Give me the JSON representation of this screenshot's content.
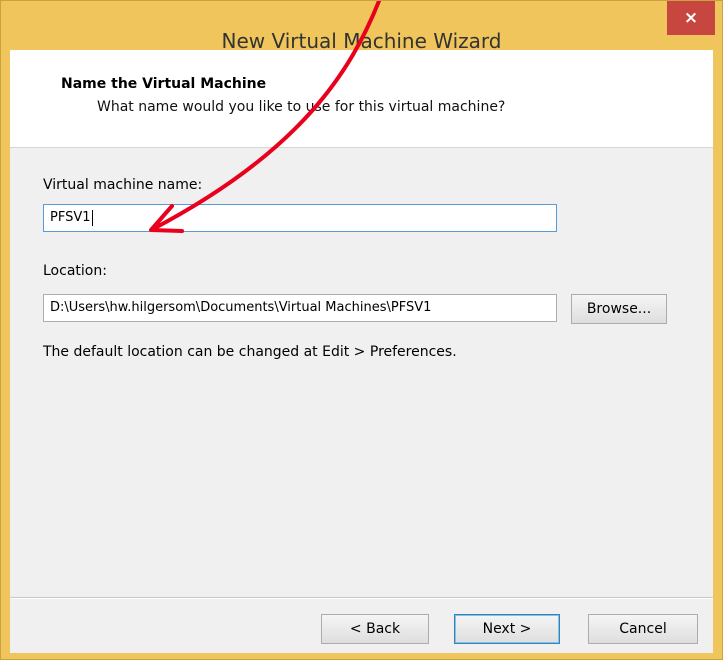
{
  "window": {
    "title": "New Virtual Machine Wizard",
    "close_glyph": "×"
  },
  "header": {
    "title": "Name the Virtual Machine",
    "subtitle": "What name would you like to use for this virtual machine?"
  },
  "form": {
    "name_label": "Virtual machine name:",
    "name_value": "PFSV1",
    "location_label": "Location:",
    "location_value": "D:\\Users\\hw.hilgersom\\Documents\\Virtual Machines\\PFSV1",
    "browse_label": "Browse...",
    "hint": "The default location can be changed at Edit > Preferences."
  },
  "footer": {
    "back_label": "< Back",
    "next_label": "Next >",
    "cancel_label": "Cancel"
  },
  "colors": {
    "frame": "#f0c55b",
    "close_button": "#c7463f",
    "annotation_arrow": "#e8001c"
  }
}
